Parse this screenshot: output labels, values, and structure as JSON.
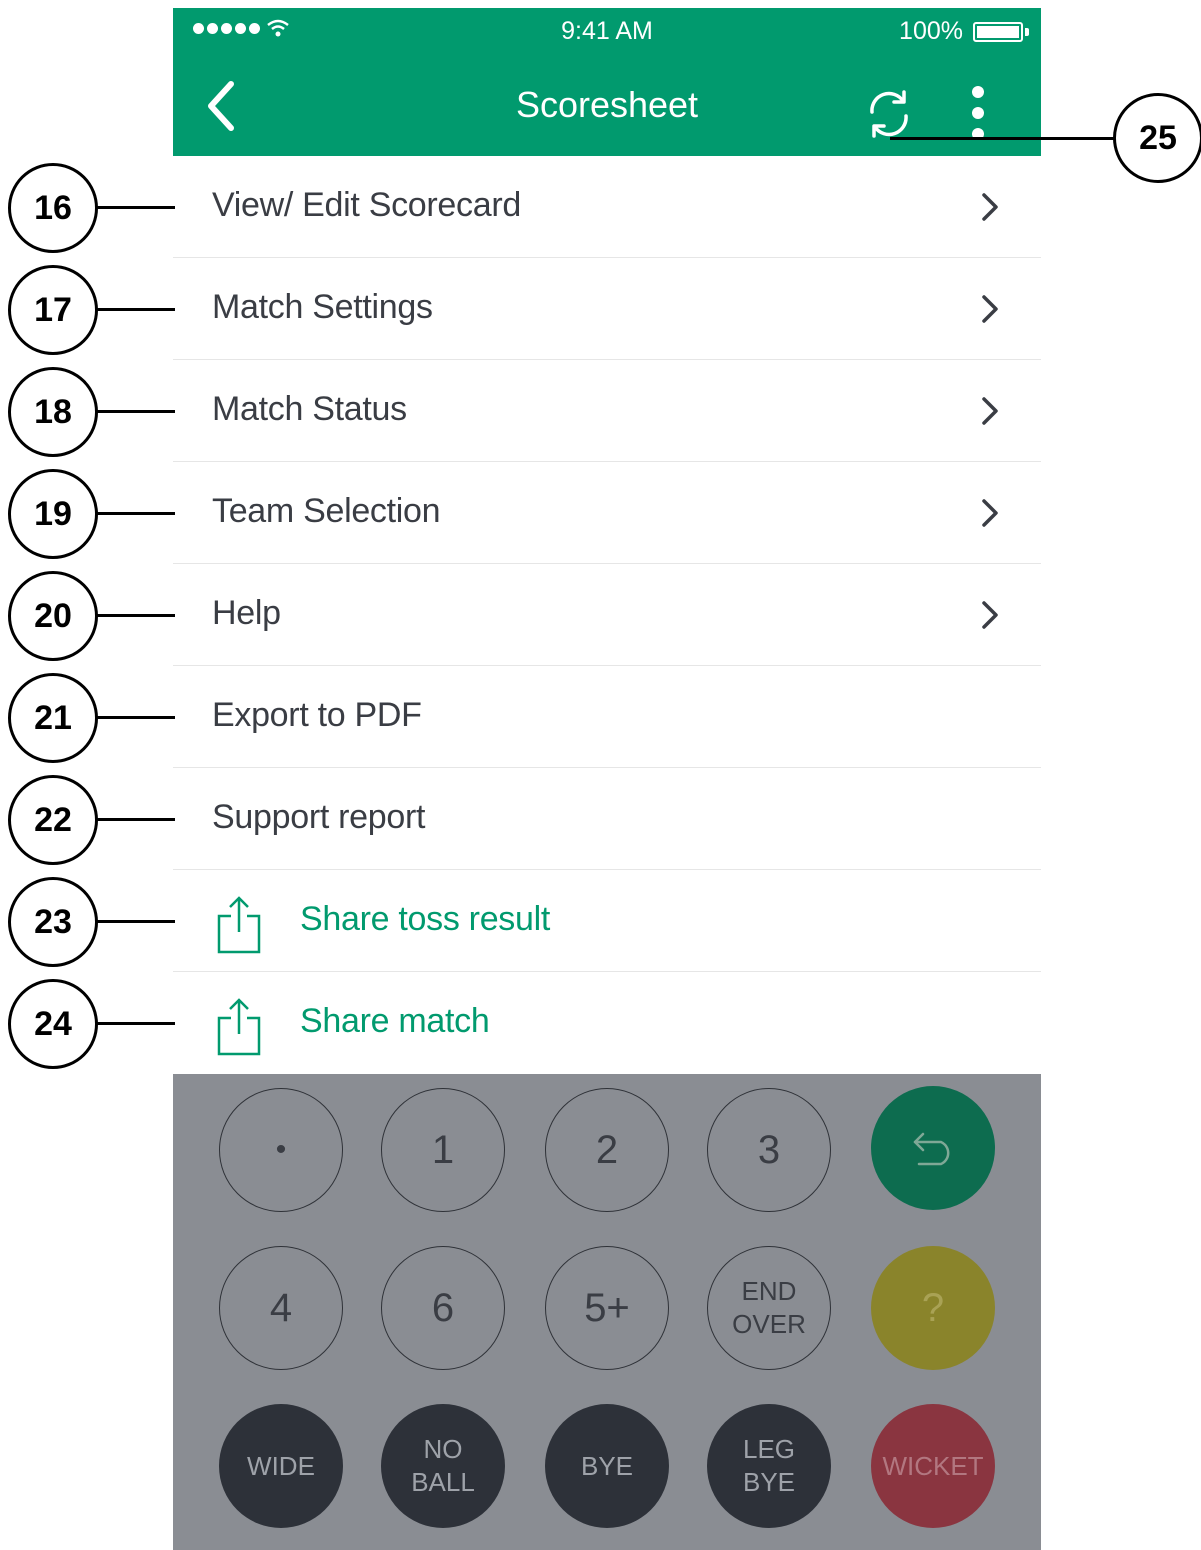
{
  "status_bar": {
    "time": "9:41 AM",
    "battery": "100%",
    "signal_icon": "signal-dots-icon",
    "wifi_icon": "wifi-icon"
  },
  "nav": {
    "title": "Scoresheet",
    "back_icon": "chevron-left-icon",
    "refresh_icon": "refresh-icon",
    "more_icon": "more-vertical-icon"
  },
  "menu": [
    {
      "label": "View/ Edit Scorecard",
      "chevron": true
    },
    {
      "label": "Match Settings",
      "chevron": true
    },
    {
      "label": "Match Status",
      "chevron": true
    },
    {
      "label": "Team Selection",
      "chevron": true
    },
    {
      "label": "Help",
      "chevron": true
    },
    {
      "label": "Export to PDF",
      "chevron": false
    },
    {
      "label": "Support report",
      "chevron": false
    },
    {
      "label": "Share toss result",
      "share": true
    },
    {
      "label": "Share match",
      "share": true
    }
  ],
  "keypad": {
    "row1": [
      "•",
      "1",
      "2",
      "3"
    ],
    "undo_icon": "undo-icon",
    "row2": [
      "4",
      "6",
      "5+",
      "END\nOVER"
    ],
    "help_key": "?",
    "row3": [
      "WIDE",
      "NO\nBALL",
      "BYE",
      "LEG\nBYE"
    ],
    "wicket_key": "WICKET"
  },
  "callouts": [
    "16",
    "17",
    "18",
    "19",
    "20",
    "21",
    "22",
    "23",
    "24",
    "25"
  ],
  "colors": {
    "brand_green": "#019a6e",
    "keypad_bg": "#8a8d93",
    "undo_green": "#0d6c4f",
    "help_yellow": "#8a842b",
    "wicket_red": "#8a3540",
    "dark_key": "#2d3139",
    "text_dark": "#3a3d44"
  }
}
